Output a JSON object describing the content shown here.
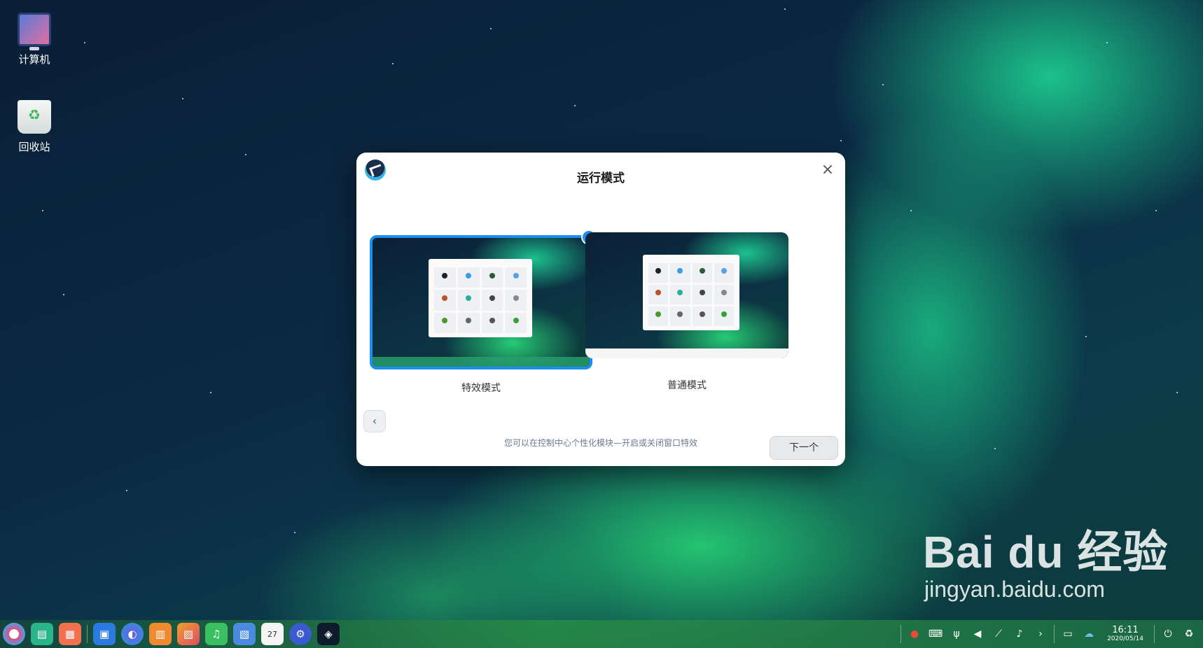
{
  "desktop": {
    "icons": [
      {
        "label": "计算机"
      },
      {
        "label": "回收站"
      }
    ]
  },
  "dialog": {
    "title": "运行模式",
    "modes": [
      {
        "label": "特效模式",
        "selected": true
      },
      {
        "label": "普通模式",
        "selected": false
      }
    ],
    "hint": "您可以在控制中心个性化模块—开启或关闭窗口特效",
    "next_label": "下一个",
    "back_glyph": "‹",
    "close_glyph": "×",
    "check_glyph": "✓"
  },
  "taskbar": {
    "clock_time": "16:11",
    "clock_date": "2020/05/14"
  },
  "watermark": {
    "main": "Bai du 经验",
    "sub": "jingyan.baidu.com"
  },
  "colors": {
    "accent": "#1b8ff0"
  }
}
